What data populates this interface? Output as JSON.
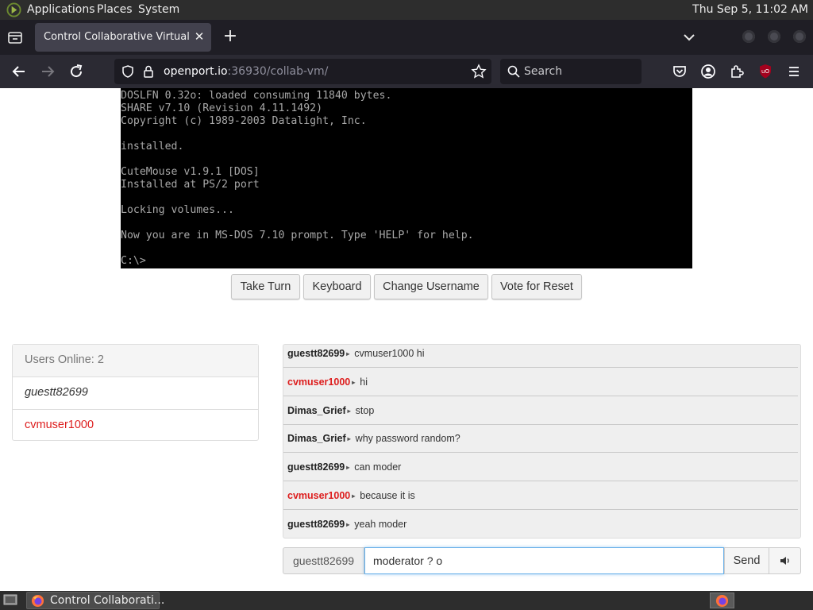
{
  "top_panel": {
    "menus": [
      "Applications",
      "Places",
      "System"
    ],
    "clock": "Thu Sep  5, 11:02 AM"
  },
  "browser": {
    "tab_title": "Control Collaborative Virtual Machines",
    "url_host": "openport.io",
    "url_rest": ":36930/collab-vm/",
    "search_placeholder": "Search"
  },
  "vm": {
    "console_lines": [
      "DOSLFN 0.32o: loaded consuming 11840 bytes.",
      "SHARE v7.10 (Revision 4.11.1492)",
      "Copyright (c) 1989-2003 Datalight, Inc.",
      "",
      "installed.",
      "",
      "CuteMouse v1.9.1 [DOS]",
      "Installed at PS/2 port",
      "",
      "Locking volumes...",
      "",
      "Now you are in MS-DOS 7.10 prompt. Type 'HELP' for help.",
      "",
      "C:\\>"
    ]
  },
  "controls": {
    "take_turn": "Take Turn",
    "keyboard": "Keyboard",
    "change_username": "Change Username",
    "vote_reset": "Vote for Reset"
  },
  "users": {
    "header": "Users Online: 2",
    "list": [
      {
        "name": "guestt82699"
      },
      {
        "name": "cvmuser1000"
      }
    ]
  },
  "chat": {
    "messages": [
      {
        "user": "guestt82699",
        "text": "cvmuser1000 hi"
      },
      {
        "user": "cvmuser1000",
        "text": "hi"
      },
      {
        "user": "Dimas_Grief",
        "text": "stop"
      },
      {
        "user": "Dimas_Grief",
        "text": "why password random?"
      },
      {
        "user": "guestt82699",
        "text": "can moder"
      },
      {
        "user": "cvmuser1000",
        "text": "because it is"
      },
      {
        "user": "guestt82699",
        "text": "yeah moder"
      }
    ],
    "username": "guestt82699",
    "input_value": "moderator ? o",
    "send_label": "Send"
  },
  "taskbar": {
    "task_label": "Control Collaborati..."
  },
  "colors": {
    "highlight_user": "#dd1d1d"
  }
}
